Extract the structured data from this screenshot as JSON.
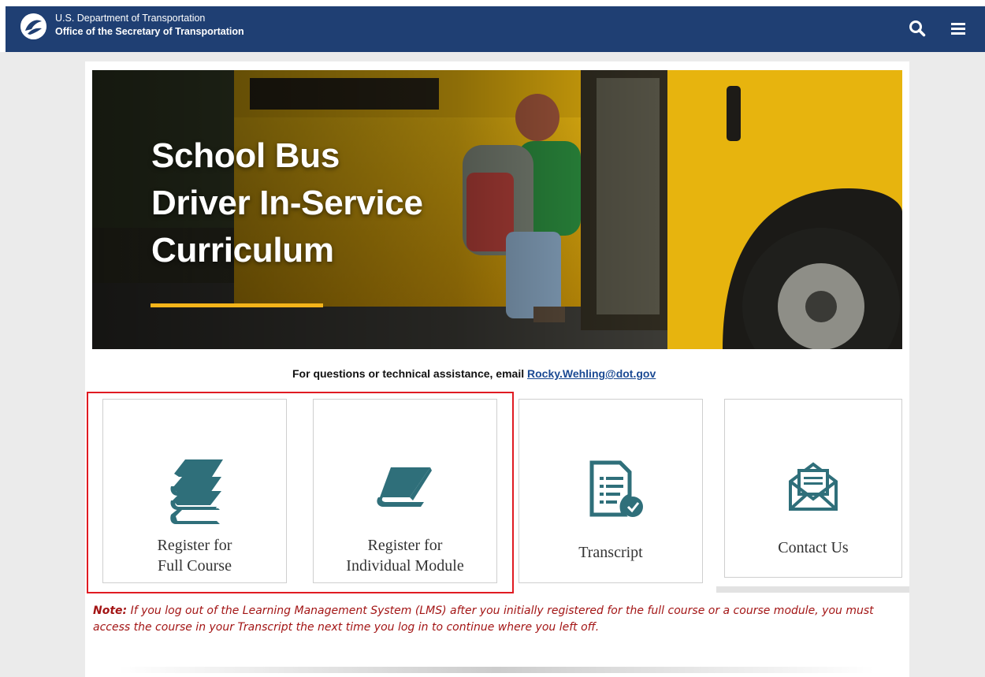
{
  "header": {
    "agency_line1": "U.S. Department of Transportation",
    "agency_line2": "Office of the Secretary of Transportation",
    "search_icon": "search-icon",
    "menu_icon": "hamburger-menu-icon",
    "bg_color": "#1f3f73"
  },
  "hero": {
    "title_lines": [
      "School Bus",
      "Driver In-Service",
      "Curriculum"
    ],
    "accent_color": "#f4b41a"
  },
  "contact": {
    "text": "For questions or technical assistance, email ",
    "email": "Rocky.Wehling@dot.gov"
  },
  "cards": [
    {
      "line1": "Register for",
      "line2": "Full Course",
      "icon": "books-stack-icon"
    },
    {
      "line1": "Register for",
      "line2": "Individual Module",
      "icon": "book-icon"
    },
    {
      "line1": "Transcript",
      "line2": "",
      "icon": "document-check-icon"
    },
    {
      "line1": "Contact Us",
      "line2": "",
      "icon": "envelope-letter-icon"
    }
  ],
  "note": {
    "label": "Note:",
    "text": " If you log out of the Learning Management System (LMS) after you initially registered for the full course or a course module, you must access the course in your Transcript the next time you log in to continue where you left off."
  },
  "colors": {
    "icon_teal": "#2f6f7a",
    "highlight_red": "#e01b22",
    "note_red": "#a31515"
  }
}
